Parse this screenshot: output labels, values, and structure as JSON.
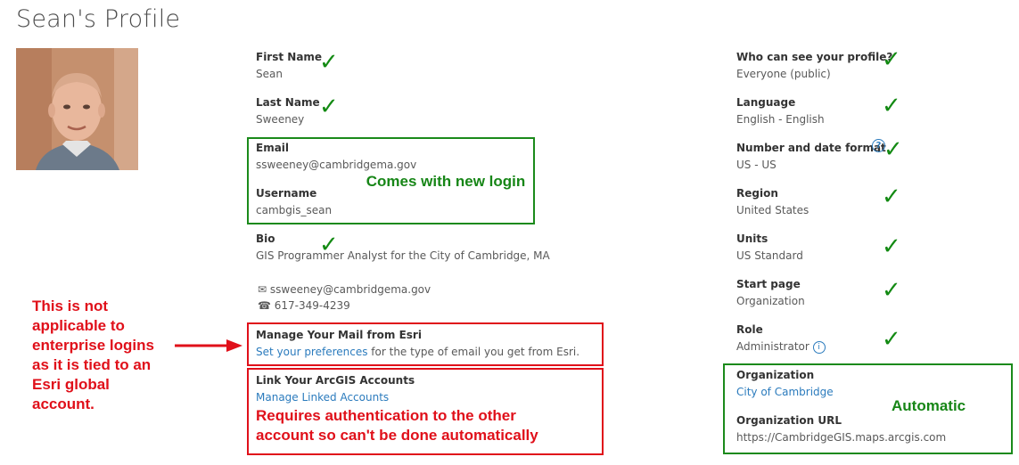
{
  "page_title": "Sean's Profile",
  "profile": {
    "first_name_label": "First Name",
    "first_name": "Sean",
    "last_name_label": "Last Name",
    "last_name": "Sweeney",
    "email_label": "Email",
    "email": "ssweeney@cambridgema.gov",
    "username_label": "Username",
    "username": "cambgis_sean",
    "bio_label": "Bio",
    "bio": "GIS Programmer Analyst for the City of Cambridge, MA",
    "contact_email": "ssweeney@cambridgema.gov",
    "contact_phone": "617-349-4239",
    "mail_label": "Manage Your Mail from Esri",
    "mail_link": "Set your preferences",
    "mail_text": " for the type of email you get from Esri.",
    "link_label": "Link Your ArcGIS Accounts",
    "link_link": "Manage Linked Accounts"
  },
  "settings": {
    "visibility_label": "Who can see your profile?",
    "visibility": "Everyone (public)",
    "language_label": "Language",
    "language": "English - English",
    "format_label": "Number and date format",
    "format": "US - US",
    "region_label": "Region",
    "region": "United States",
    "units_label": "Units",
    "units": "US Standard",
    "start_label": "Start page",
    "start": "Organization",
    "role_label": "Role",
    "role": "Administrator",
    "org_label": "Organization",
    "org": "City of Cambridge",
    "org_url_label": "Organization URL",
    "org_url": "https://CambridgeGIS.maps.arcgis.com"
  },
  "annotations": {
    "new_login": "Comes with new login",
    "automatic": "Automatic",
    "not_applicable": [
      "This is not",
      "applicable to",
      "enterprise logins",
      "as it is tied to an",
      "Esri global",
      "account."
    ],
    "requires_auth": [
      "Requires authentication to the other",
      "account so can't be done automatically"
    ]
  },
  "icons": {
    "check": "✓",
    "help": "?",
    "info": "i",
    "mail": "✉",
    "phone": "☎"
  },
  "colors": {
    "green": "#1b8a1b",
    "red": "#e0101a",
    "link": "#2b7bbd"
  }
}
